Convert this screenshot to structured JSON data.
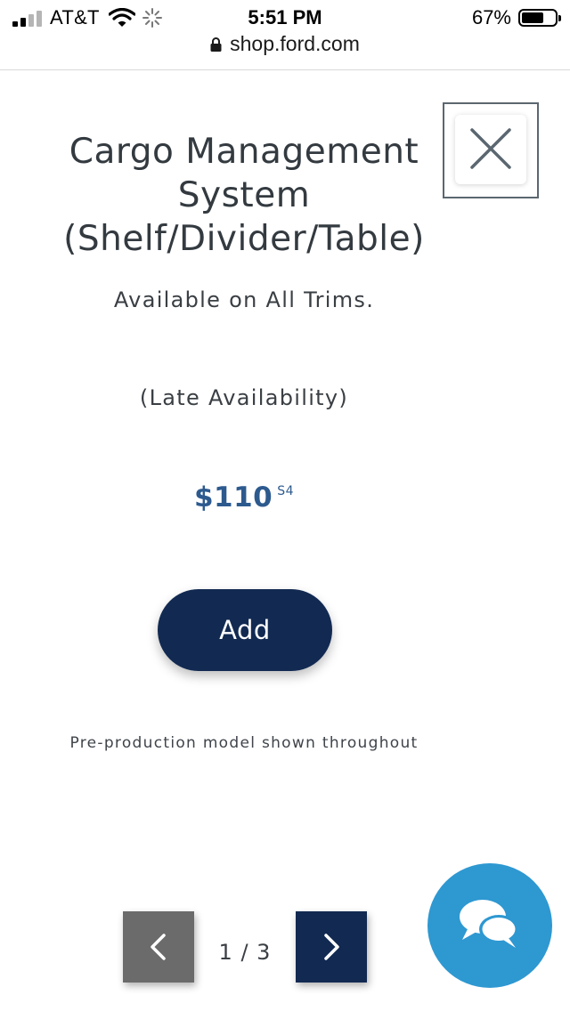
{
  "status_bar": {
    "carrier": "AT&T",
    "time": "5:51 PM",
    "battery_percent": "67%",
    "battery_level": 0.67,
    "signal_bars": 2
  },
  "browser": {
    "url": "shop.ford.com"
  },
  "product": {
    "title_line1": "Cargo Management System",
    "title_line2": "(Shelf/Divider/Table)",
    "availability": "Available on All Trims.",
    "availability_note": "(Late Availability)",
    "price": "$110",
    "price_footnote": "S4"
  },
  "actions": {
    "add_label": "Add"
  },
  "disclaimer": "Pre-production model shown throughout",
  "pager": {
    "current": "1",
    "total": "3",
    "indicator": "1 / 3"
  },
  "icons": {
    "close": "close-icon",
    "prev": "chevron-left-icon",
    "next": "chevron-right-icon",
    "chat": "chat-bubbles-icon"
  },
  "colors": {
    "primary": "#122a52",
    "price": "#2d5a8e",
    "chat": "#2e98d1",
    "pager_disabled": "#6b6b6b"
  }
}
